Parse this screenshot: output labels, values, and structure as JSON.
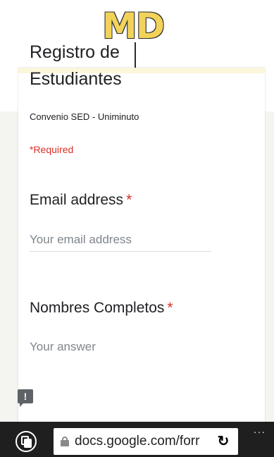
{
  "header": {
    "title_fragment": "., , )",
    "logo_text": "MD"
  },
  "form": {
    "title": "Registro de Estudiantes",
    "description": "Convenio SED - Uniminuto",
    "required_note": "*Required",
    "questions": [
      {
        "label": "Email address",
        "required_mark": "*",
        "placeholder": "Your email address"
      },
      {
        "label": "Nombres Completos",
        "required_mark": "*",
        "placeholder": "Your answer"
      }
    ]
  },
  "browser": {
    "url": "docs.google.com/forr",
    "more_label": "...",
    "reload_glyph": "↻"
  },
  "feedback": {
    "glyph": "!"
  },
  "icons": {
    "tabs": "tabs-icon",
    "lock": "lock-icon",
    "reload": "reload-icon",
    "more": "more-icon",
    "feedback": "feedback-icon"
  },
  "colors": {
    "accent_required": "#d93025",
    "card_header": "#fbf7dd",
    "browser_bar": "#1f1f1f",
    "logo": "#f2d35a"
  }
}
